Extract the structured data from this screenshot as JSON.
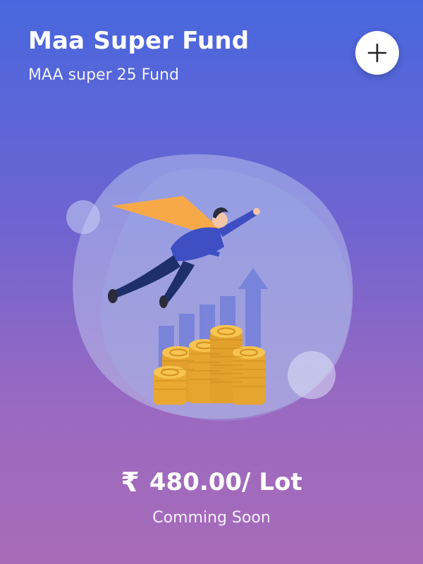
{
  "fund": {
    "title": "Maa Super Fund",
    "subtitle": "MAA super 25 Fund",
    "currency_symbol": "₹",
    "price_label": "480.00/ Lot",
    "status": "Comming Soon"
  },
  "actions": {
    "add_icon": "plus-icon"
  },
  "illustration": {
    "subject": "flying-superhero-investor",
    "elements": [
      "blob-background",
      "bar-chart",
      "up-arrow",
      "gold-coin-stacks"
    ]
  },
  "colors": {
    "gradient_top": "#4867de",
    "gradient_bottom": "#a86bb8",
    "cape": "#f7a94a",
    "suit": "#3d4fc2",
    "pants": "#1e2f6b",
    "coin": "#f2b23a"
  }
}
